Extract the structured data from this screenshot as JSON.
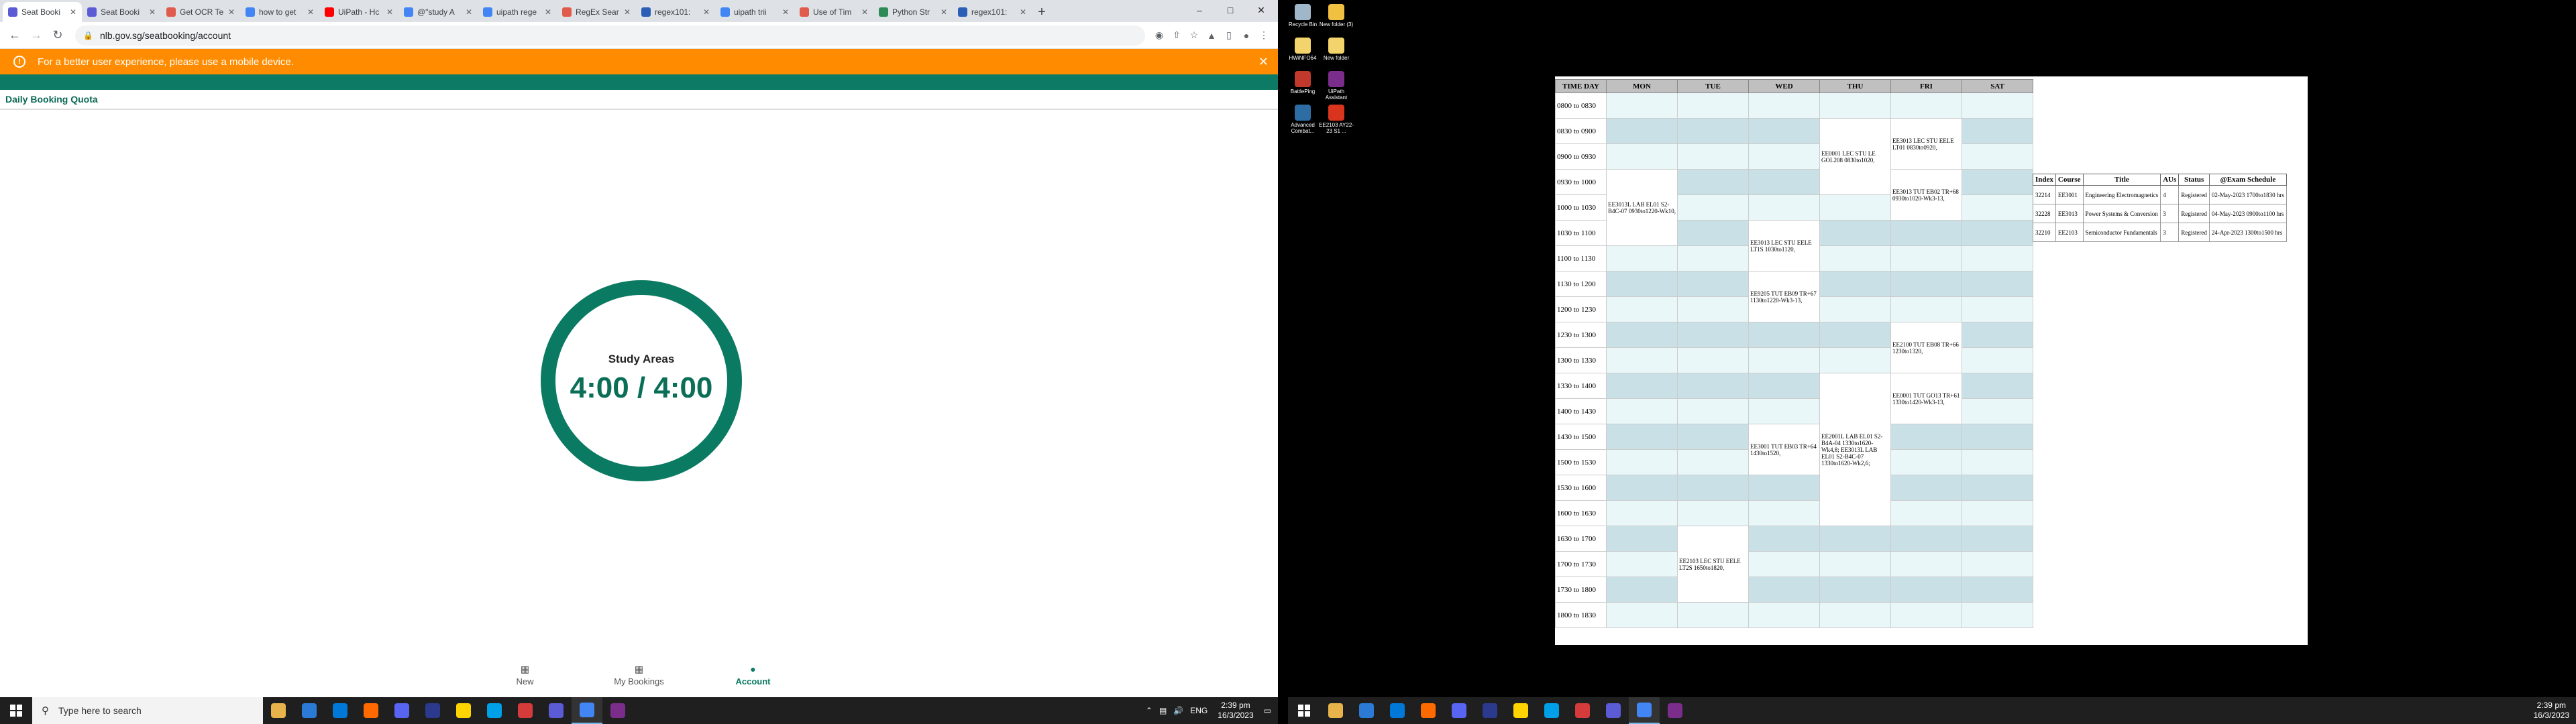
{
  "browser": {
    "tabs": [
      {
        "title": "Seat Booki",
        "color": "#5b5bd6",
        "active": true
      },
      {
        "title": "Seat Booki",
        "color": "#5b5bd6"
      },
      {
        "title": "Get OCR Te",
        "color": "#e05b4b"
      },
      {
        "title": "how to get",
        "color": "#4285f4"
      },
      {
        "title": "UiPath - Hc",
        "color": "#ff0000"
      },
      {
        "title": "@\"study A",
        "color": "#4285f4"
      },
      {
        "title": "uipath rege",
        "color": "#4285f4"
      },
      {
        "title": "RegEx Sear",
        "color": "#e05b4b"
      },
      {
        "title": "regex101:",
        "color": "#2a5fb5"
      },
      {
        "title": "uipath trii",
        "color": "#4285f4"
      },
      {
        "title": "Use of Tim",
        "color": "#e05b4b"
      },
      {
        "title": "Python Str",
        "color": "#2e8b57"
      },
      {
        "title": "regex101:",
        "color": "#2a5fb5"
      }
    ],
    "url": "nlb.gov.sg/seatbooking/account"
  },
  "page": {
    "banner_text": "For a better user experience, please use a mobile device.",
    "quota_title": "Daily Booking Quota",
    "ring_label": "Study Areas",
    "ring_value": "4:00 / 4:00",
    "ring_fraction": 1.0,
    "nav": [
      {
        "label": "New",
        "icon": "calendar-icon"
      },
      {
        "label": "My Bookings",
        "icon": "calendar-icon"
      },
      {
        "label": "Account",
        "icon": "account-icon",
        "active": true
      }
    ]
  },
  "taskbar_left": {
    "search_placeholder": "Type here to search",
    "lang": "ENG",
    "time": "2:39 pm",
    "date": "16/3/2023"
  },
  "taskbar_right": {
    "time": "2:39 pm",
    "date": "16/3/2023"
  },
  "desktop_icons": [
    {
      "label": "Recycle Bin",
      "color": "#9fb7c9"
    },
    {
      "label": "New folder (3)",
      "color": "#f0c040"
    },
    {
      "label": "HWiNFO64",
      "color": "#f3d36b"
    },
    {
      "label": "New folder",
      "color": "#f3d36b"
    },
    {
      "label": "BattlePing",
      "color": "#c0392b"
    },
    {
      "label": "UiPath Assistant",
      "color": "#7b2d8b"
    },
    {
      "label": "Advanced Combat...",
      "color": "#2e6da4"
    },
    {
      "label": "EE2103 AY22-23 S1 ...",
      "color": "#d9341e"
    }
  ],
  "timetable": {
    "headers": [
      "TIME DAY",
      "MON",
      "TUE",
      "WED",
      "THU",
      "FRI",
      "SAT"
    ],
    "times": [
      "0800 to 0830",
      "0830 to 0900",
      "0900 to 0930",
      "0930 to 1000",
      "1000 to 1030",
      "1030 to 1100",
      "1100 to 1130",
      "1130 to 1200",
      "1200 to 1230",
      "1230 to 1300",
      "1300 to 1330",
      "1330 to 1400",
      "1400 to 1430",
      "1430 to 1500",
      "1500 to 1530",
      "1530 to 1600",
      "1600 to 1630",
      "1630 to 1700",
      "1700 to 1730",
      "1730 to 1800",
      "1800 to 1830"
    ],
    "events": {
      "mon_lab": "EE3013L LAB EL01 S2-B4C-07 0930to1220-Wk10,",
      "wed_lec": "EE3013 LEC STU EELE LT1S 1030to1120,",
      "wed_tut": "EE9205 TUT EB09 TR+67 1130to1220-Wk3-13,",
      "wed_tut2": "EE3001 TUT EB03 TR+64 1430to1520,",
      "thu_lec": "EE0001 LEC STU LE GOL208 0830to1020,",
      "thu_lab": "EE2001L LAB EL01 S2-B4A-04 1330to1620-Wk4,8; EE3013L LAB EL01 S2-B4C-07 1330to1620-Wk2,6;",
      "fri_lec": "EE3013 LEC STU EELE LT01 0830to0920,",
      "fri_tut": "EE3013 TUT EB02 TR+68 0930to1020-Wk3-13,",
      "fri_tut2": "EE2100 TUT EB08 TR+66 1230to1320,",
      "fri_tut3": "EE0001 TUT GO13 TR+61 1330to1420-Wk3-13,",
      "tue_lec": "EE2103 LEC STU EELE LT2S 1650to1820,"
    }
  },
  "courses": {
    "headers": [
      "Index",
      "Course",
      "Title",
      "AUs",
      "Status",
      "@Exam Schedule"
    ],
    "rows": [
      [
        "32214",
        "EE3001",
        "Engineering Electromagnetics",
        "4",
        "Registered",
        "02-May-2023 1700to1830 hrs"
      ],
      [
        "32228",
        "EE3013",
        "Power Systems & Conversion",
        "3",
        "Registered",
        "04-May-2023 0900to1100 hrs"
      ],
      [
        "32210",
        "EE2103",
        "Semiconductor Fundamentals",
        "3",
        "Registered",
        "24-Apr-2023 1300to1500 hrs"
      ]
    ]
  }
}
